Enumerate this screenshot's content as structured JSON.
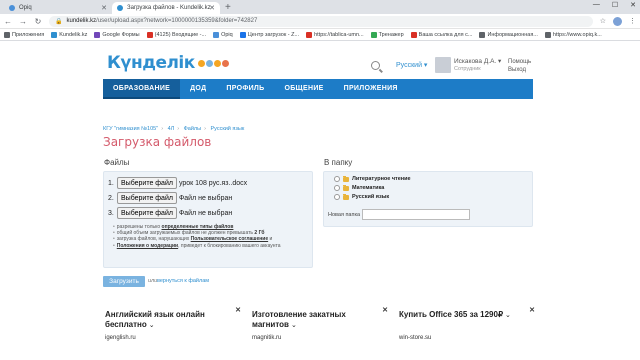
{
  "browser": {
    "tabs": [
      {
        "title": "Opiq",
        "active": false,
        "favicon_color": "#4a90d9"
      },
      {
        "title": "Загрузка файлов - Kundelik.kz",
        "active": true,
        "favicon_color": "#2f8fcf"
      }
    ],
    "new_tab": "+",
    "window_controls": [
      "—",
      "☐",
      "✕"
    ],
    "url_host": "kundelik.kz",
    "url_path": "/user/upload.aspx?network=1000000135359&folder=742827",
    "bookmarks": [
      {
        "label": "Приложения",
        "color": "#5f6368"
      },
      {
        "label": "Kundelik.kz",
        "color": "#2f8fcf"
      },
      {
        "label": "Google Формы",
        "color": "#7248b9"
      },
      {
        "label": "(4125) Входящие -...",
        "color": "#d93025"
      },
      {
        "label": "Opiq",
        "color": "#4a90d9"
      },
      {
        "label": "Центр загрузок - Z...",
        "color": "#1a73e8"
      },
      {
        "label": "https://tablica-umn...",
        "color": "#d93025"
      },
      {
        "label": "Тренажер",
        "color": "#34a853"
      },
      {
        "label": "Ваша ссылка для с...",
        "color": "#d93025"
      },
      {
        "label": "Информационная...",
        "color": "#5f6368"
      },
      {
        "label": "https://www.opiq.k...",
        "color": "#5f6368"
      }
    ]
  },
  "site": {
    "logo": "Күнделік",
    "language": "Русский ▾",
    "user_name": "Искакова Д.А. ▾",
    "user_role": "Сотрудник",
    "help": "Помощь",
    "logout": "Выход",
    "nav": [
      "ОБРАЗОВАНИЕ",
      "ДОД",
      "ПРОФИЛЬ",
      "ОБЩЕНИЕ",
      "ПРИЛОЖЕНИЯ"
    ]
  },
  "breadcrumb": [
    "КГУ \"гимназия №105\"",
    "4Л",
    "Файлы",
    "Русский язык"
  ],
  "page_title": "Загрузка файлов",
  "files": {
    "title": "Файлы",
    "button_label": "Выберите файл",
    "rows": [
      {
        "num": "1.",
        "status": "урок 108 рус.яз..docx"
      },
      {
        "num": "2.",
        "status": "Файл не выбран"
      },
      {
        "num": "3.",
        "status": "Файл не выбран"
      }
    ],
    "rules": [
      {
        "text": "разрешены только ",
        "bold": "определенные типы файлов",
        "after": ""
      },
      {
        "text": "общий объем загружаемых файлов не должен превышать ",
        "bold": "2 Гб",
        "after": ""
      },
      {
        "text": "загрузка файлов, нарушающих ",
        "bold": "Пользовательское соглашение",
        "after": " и"
      },
      {
        "text": "",
        "bold": "Положения о модерации",
        "after": ", приведет к блокированию вашего аккаунта"
      }
    ]
  },
  "folder": {
    "title": "В папку",
    "items": [
      "Литературное чтение",
      "Математика",
      "Русский язык"
    ],
    "new_folder_label": "Новая папка",
    "new_folder_value": ""
  },
  "actions": {
    "upload": "Загрузить",
    "or": "или",
    "back": "вернуться к файлам"
  },
  "ads": [
    {
      "title": "Английский язык онлайн бесплатно",
      "url": "igenglish.ru"
    },
    {
      "title": "Изготовление закатных магнитов",
      "url": "magnitik.ru"
    },
    {
      "title": "Купить Office 365 за 1290₽",
      "url": "win-store.su"
    }
  ]
}
